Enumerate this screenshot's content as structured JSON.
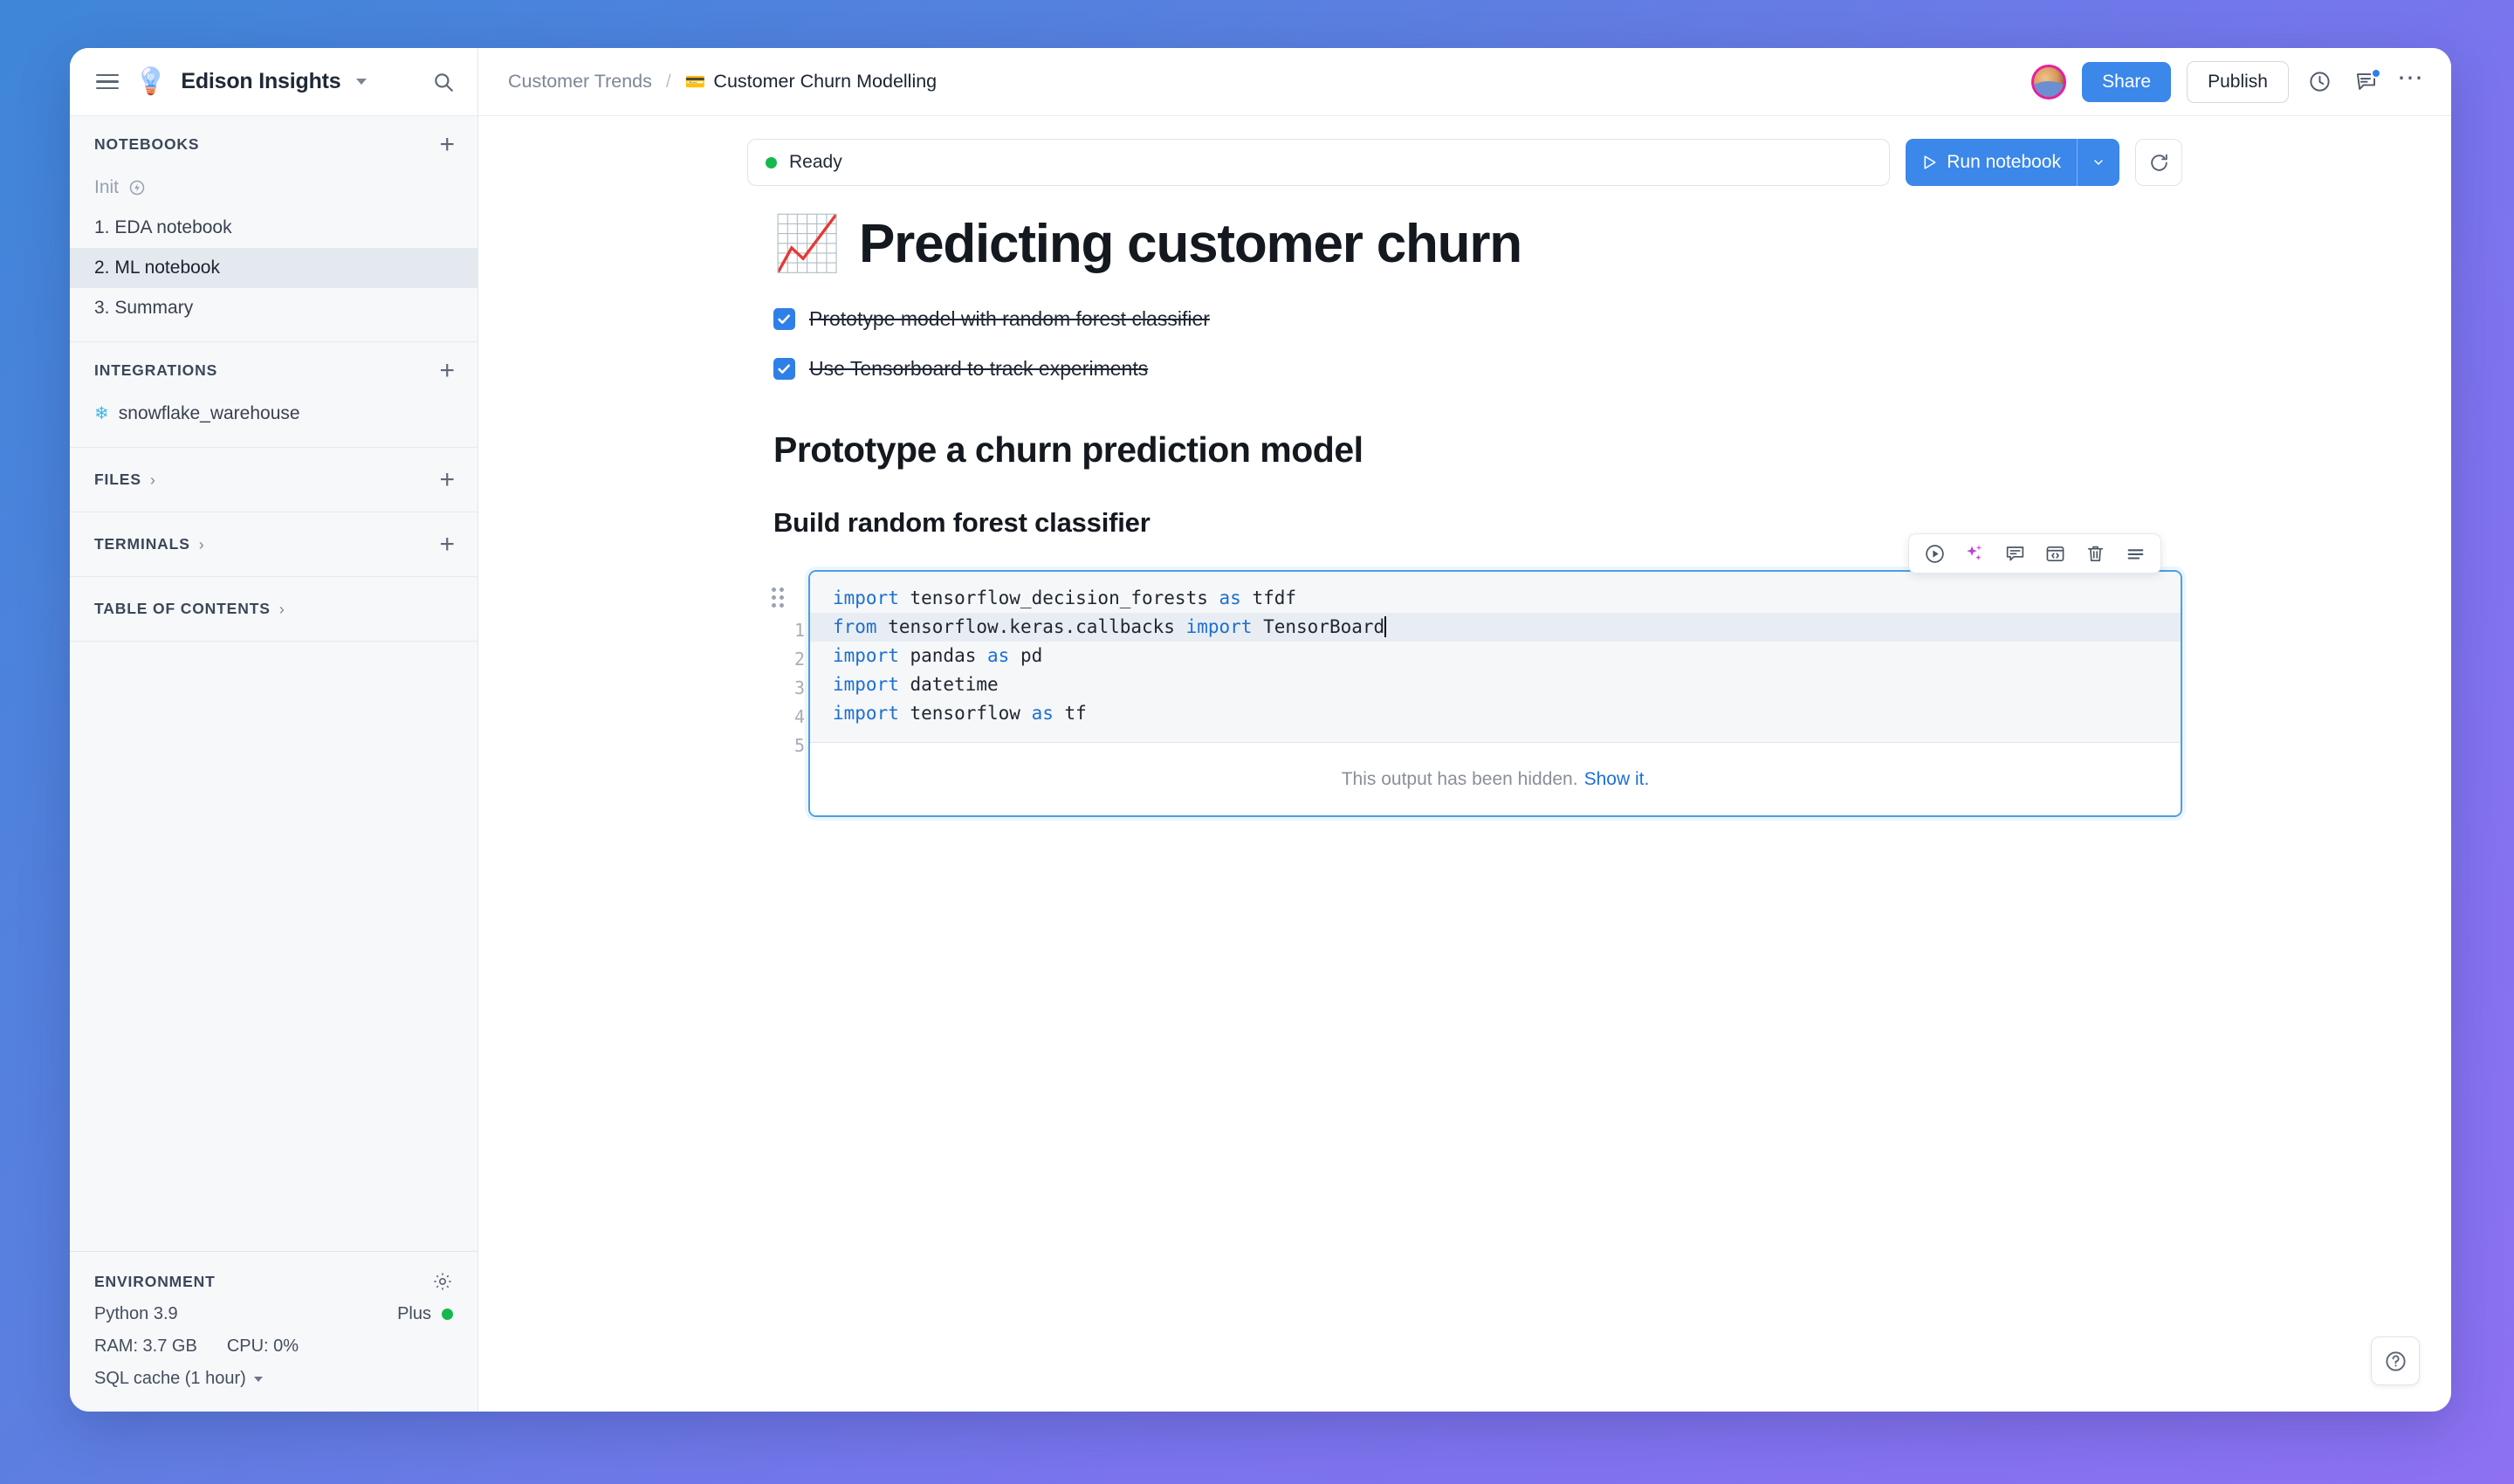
{
  "brand": {
    "name": "Edison Insights",
    "logo_icon": "lightbulb-icon",
    "menu_icon": "hamburger-icon",
    "search_icon": "search-icon",
    "caret_icon": "chevron-down-icon"
  },
  "sidebar": {
    "sections": [
      {
        "title": "NOTEBOOKS",
        "add_icon": "plus-icon",
        "items": [
          {
            "label": "Init",
            "state": "muted",
            "icon": "lightning-circle-icon"
          },
          {
            "label": "1. EDA notebook",
            "state": "normal"
          },
          {
            "label": "2. ML notebook",
            "state": "active"
          },
          {
            "label": "3. Summary",
            "state": "normal"
          }
        ]
      },
      {
        "title": "INTEGRATIONS",
        "add_icon": "plus-icon",
        "items": [
          {
            "label": "snowflake_warehouse",
            "state": "normal",
            "icon": "snowflake-icon"
          }
        ]
      },
      {
        "title": "FILES",
        "chevron": "›",
        "add_icon": "plus-icon",
        "items": []
      },
      {
        "title": "TERMINALS",
        "chevron": "›",
        "add_icon": "plus-icon",
        "items": []
      },
      {
        "title": "TABLE OF CONTENTS",
        "chevron": "›",
        "items": []
      }
    ],
    "environment": {
      "title": "ENVIRONMENT",
      "gear_icon": "gear-icon",
      "runtime": "Python 3.9",
      "plan": "Plus",
      "plan_status_color": "#15b84d",
      "ram": "RAM: 3.7 GB",
      "cpu": "CPU: 0%",
      "sql_cache": "SQL cache (1 hour)"
    }
  },
  "topbar": {
    "breadcrumb_parent": "Customer Trends",
    "breadcrumb_separator": "/",
    "breadcrumb_emoji": "💳",
    "breadcrumb_current": "Customer Churn Modelling",
    "avatar_name": "avatar",
    "share_label": "Share",
    "publish_label": "Publish",
    "history_icon": "clock-icon",
    "comments_icon": "comments-icon",
    "more_icon": "ellipsis-icon",
    "accent_color": "#3b87ea"
  },
  "runbar": {
    "status_label": "Ready",
    "status_color": "#15b84d",
    "run_label": "Run notebook",
    "run_icon": "play-icon",
    "run_caret_icon": "chevron-down-icon",
    "refresh_icon": "refresh-icon"
  },
  "notebook": {
    "title": "Predicting customer churn",
    "title_emoji": "📈",
    "todos": [
      {
        "label": "Prototype model with random forest classifier",
        "checked": true
      },
      {
        "label": "Use Tensorboard to track experiments",
        "checked": true
      }
    ],
    "heading_2": "Prototype a churn prediction model",
    "heading_3": "Build random forest classifier",
    "cell": {
      "line_numbers": [
        "1",
        "2",
        "3",
        "4",
        "5"
      ],
      "lines": [
        [
          {
            "t": "import",
            "c": "kw"
          },
          {
            "t": " tensorflow_decision_forests ",
            "c": ""
          },
          {
            "t": "as",
            "c": "kw"
          },
          {
            "t": " tfdf",
            "c": ""
          }
        ],
        [
          {
            "t": "from",
            "c": "kw"
          },
          {
            "t": " tensorflow.keras.callbacks ",
            "c": ""
          },
          {
            "t": "import",
            "c": "kw"
          },
          {
            "t": " TensorBoard",
            "c": ""
          }
        ],
        [
          {
            "t": "import",
            "c": "kw"
          },
          {
            "t": " pandas ",
            "c": ""
          },
          {
            "t": "as",
            "c": "kw"
          },
          {
            "t": " pd",
            "c": ""
          }
        ],
        [
          {
            "t": "import",
            "c": "kw"
          },
          {
            "t": " datetime",
            "c": ""
          }
        ],
        [
          {
            "t": "import",
            "c": "kw"
          },
          {
            "t": " tensorflow ",
            "c": ""
          },
          {
            "t": "as",
            "c": "kw"
          },
          {
            "t": " tf",
            "c": ""
          }
        ]
      ],
      "highlighted_line_index": 1,
      "output_text": "This output has been hidden.",
      "output_link": "Show it.",
      "toolbar": [
        {
          "icon": "play-circle-icon",
          "name": "run-cell-button"
        },
        {
          "icon": "ai-sparkles-icon",
          "name": "ai-assist-button"
        },
        {
          "icon": "comment-icon",
          "name": "comment-button"
        },
        {
          "icon": "code-block-icon",
          "name": "convert-to-code-button"
        },
        {
          "icon": "trash-icon",
          "name": "delete-cell-button"
        },
        {
          "icon": "menu-icon",
          "name": "cell-menu-button"
        }
      ]
    }
  },
  "help": {
    "icon": "question-mark-icon"
  }
}
